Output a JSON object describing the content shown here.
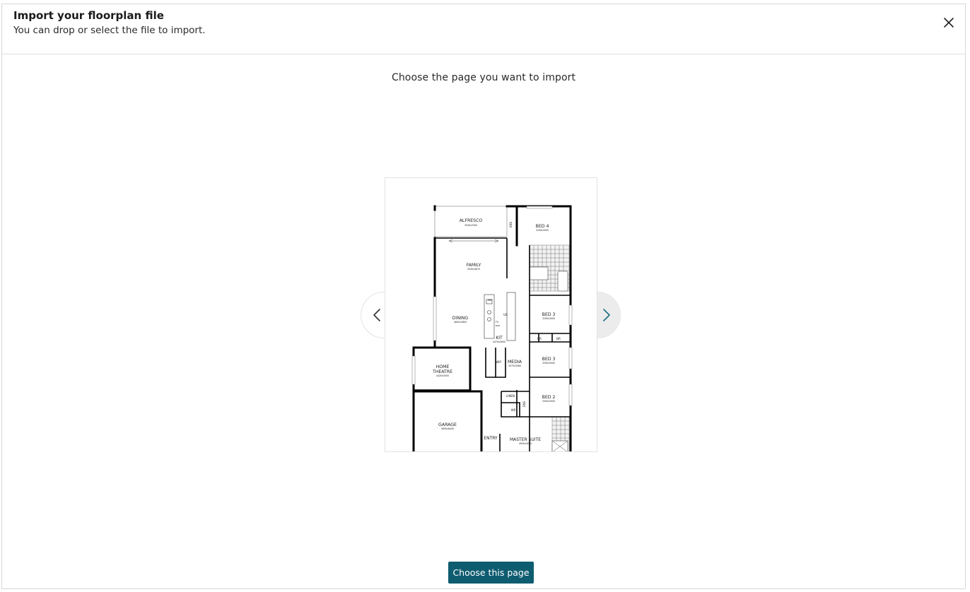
{
  "header": {
    "title": "Import your floorplan file",
    "subtitle": "You can drop or select the file to import."
  },
  "prompt": "Choose the page you want to import",
  "primary_action": {
    "label": "Choose this page",
    "color": "#0e5c70"
  },
  "icons": {
    "close": "close-icon",
    "prev": "chevron-left-icon",
    "next": "chevron-right-icon"
  },
  "floorplan": {
    "rooms": [
      {
        "name": "ALFRESCO",
        "dims": "3540x3300"
      },
      {
        "name": "BED 4",
        "dims": "4100x3000"
      },
      {
        "name": "FAMILY",
        "dims": "4540x4870"
      },
      {
        "name": "DINING",
        "dims": "4600x3800"
      },
      {
        "name": "KIT",
        "dims": "4470x2600"
      },
      {
        "name": "BED 3",
        "dims": "3290x3000"
      },
      {
        "name": "BED 3",
        "dims": "3290x3000"
      },
      {
        "name": "HOME THEATRE",
        "dims": "4420x3000"
      },
      {
        "name": "MEDIA",
        "dims": "3075x3960"
      },
      {
        "name": "BED 2",
        "dims": "3300x3000"
      },
      {
        "name": "GARAGE",
        "dims": "5800x6400"
      },
      {
        "name": "ENTRY",
        "dims": ""
      },
      {
        "name": "MASTER SUITE",
        "dims": "4900x4000"
      }
    ],
    "small_labels": [
      "ENS",
      "WIP",
      "BR",
      "BR",
      "WIP",
      "LINEN",
      "ENS",
      "WR",
      "UE",
      "TV",
      "BAR"
    ]
  }
}
